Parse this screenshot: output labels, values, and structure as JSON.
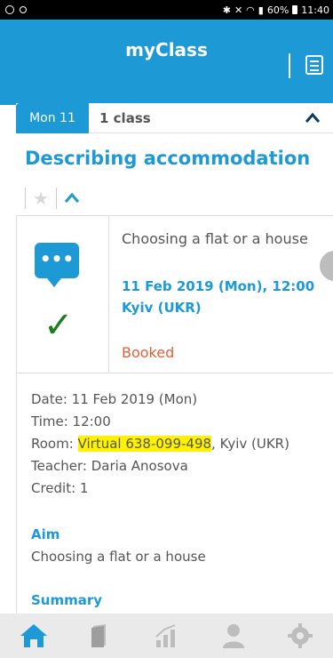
{
  "status_bar": {
    "right_text": "60%",
    "time": "11:40"
  },
  "header": {
    "title": "myClass"
  },
  "day_bar": {
    "day_label": "Mon 11",
    "class_count": "1 class"
  },
  "lesson": {
    "title": "Describing accommodation",
    "topic": "Choosing a flat or a house",
    "datetime": "11 Feb 2019 (Mon), 12:00",
    "location": "Kyiv (UKR)",
    "status": "Booked"
  },
  "details": {
    "date": "Date: 11 Feb 2019 (Mon)",
    "time": "Time: 12:00",
    "room_prefix": "Room: ",
    "room_highlight": "Virtual 638-099-498",
    "room_suffix": ", Kyiv (UKR)",
    "teacher": "Teacher: Daria Anosova",
    "credit": "Credit: 1",
    "aim_heading": "Aim",
    "aim_text": "Choosing a flat or a house",
    "summary_heading": "Summary"
  },
  "bottom_nav": {
    "items": [
      {
        "icon": "home-icon",
        "active": true
      },
      {
        "icon": "book-icon",
        "active": false
      },
      {
        "icon": "chart-icon",
        "active": false
      },
      {
        "icon": "profile-icon",
        "active": false
      },
      {
        "icon": "settings-icon",
        "active": false
      }
    ]
  },
  "colors": {
    "brand": "#1d9ad6",
    "booked": "#e0603a",
    "check": "#1a7f1a",
    "highlight": "#fff200"
  }
}
